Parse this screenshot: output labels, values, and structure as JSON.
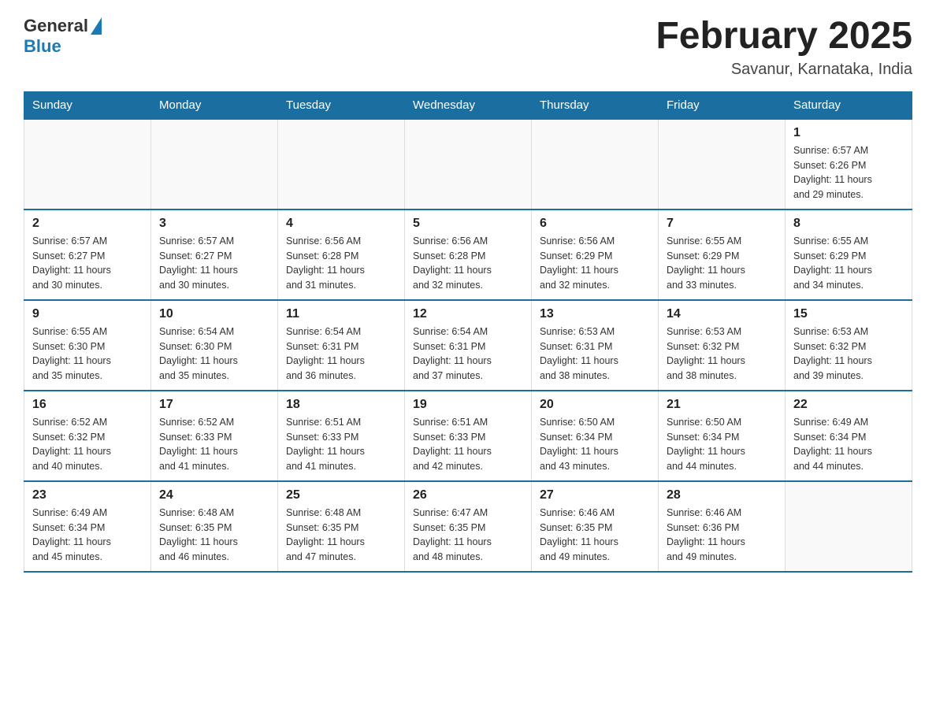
{
  "logo": {
    "general": "General",
    "blue": "Blue"
  },
  "title": "February 2025",
  "location": "Savanur, Karnataka, India",
  "days_of_week": [
    "Sunday",
    "Monday",
    "Tuesday",
    "Wednesday",
    "Thursday",
    "Friday",
    "Saturday"
  ],
  "weeks": [
    {
      "days": [
        {
          "date": "",
          "info": ""
        },
        {
          "date": "",
          "info": ""
        },
        {
          "date": "",
          "info": ""
        },
        {
          "date": "",
          "info": ""
        },
        {
          "date": "",
          "info": ""
        },
        {
          "date": "",
          "info": ""
        },
        {
          "date": "1",
          "info": "Sunrise: 6:57 AM\nSunset: 6:26 PM\nDaylight: 11 hours\nand 29 minutes."
        }
      ]
    },
    {
      "days": [
        {
          "date": "2",
          "info": "Sunrise: 6:57 AM\nSunset: 6:27 PM\nDaylight: 11 hours\nand 30 minutes."
        },
        {
          "date": "3",
          "info": "Sunrise: 6:57 AM\nSunset: 6:27 PM\nDaylight: 11 hours\nand 30 minutes."
        },
        {
          "date": "4",
          "info": "Sunrise: 6:56 AM\nSunset: 6:28 PM\nDaylight: 11 hours\nand 31 minutes."
        },
        {
          "date": "5",
          "info": "Sunrise: 6:56 AM\nSunset: 6:28 PM\nDaylight: 11 hours\nand 32 minutes."
        },
        {
          "date": "6",
          "info": "Sunrise: 6:56 AM\nSunset: 6:29 PM\nDaylight: 11 hours\nand 32 minutes."
        },
        {
          "date": "7",
          "info": "Sunrise: 6:55 AM\nSunset: 6:29 PM\nDaylight: 11 hours\nand 33 minutes."
        },
        {
          "date": "8",
          "info": "Sunrise: 6:55 AM\nSunset: 6:29 PM\nDaylight: 11 hours\nand 34 minutes."
        }
      ]
    },
    {
      "days": [
        {
          "date": "9",
          "info": "Sunrise: 6:55 AM\nSunset: 6:30 PM\nDaylight: 11 hours\nand 35 minutes."
        },
        {
          "date": "10",
          "info": "Sunrise: 6:54 AM\nSunset: 6:30 PM\nDaylight: 11 hours\nand 35 minutes."
        },
        {
          "date": "11",
          "info": "Sunrise: 6:54 AM\nSunset: 6:31 PM\nDaylight: 11 hours\nand 36 minutes."
        },
        {
          "date": "12",
          "info": "Sunrise: 6:54 AM\nSunset: 6:31 PM\nDaylight: 11 hours\nand 37 minutes."
        },
        {
          "date": "13",
          "info": "Sunrise: 6:53 AM\nSunset: 6:31 PM\nDaylight: 11 hours\nand 38 minutes."
        },
        {
          "date": "14",
          "info": "Sunrise: 6:53 AM\nSunset: 6:32 PM\nDaylight: 11 hours\nand 38 minutes."
        },
        {
          "date": "15",
          "info": "Sunrise: 6:53 AM\nSunset: 6:32 PM\nDaylight: 11 hours\nand 39 minutes."
        }
      ]
    },
    {
      "days": [
        {
          "date": "16",
          "info": "Sunrise: 6:52 AM\nSunset: 6:32 PM\nDaylight: 11 hours\nand 40 minutes."
        },
        {
          "date": "17",
          "info": "Sunrise: 6:52 AM\nSunset: 6:33 PM\nDaylight: 11 hours\nand 41 minutes."
        },
        {
          "date": "18",
          "info": "Sunrise: 6:51 AM\nSunset: 6:33 PM\nDaylight: 11 hours\nand 41 minutes."
        },
        {
          "date": "19",
          "info": "Sunrise: 6:51 AM\nSunset: 6:33 PM\nDaylight: 11 hours\nand 42 minutes."
        },
        {
          "date": "20",
          "info": "Sunrise: 6:50 AM\nSunset: 6:34 PM\nDaylight: 11 hours\nand 43 minutes."
        },
        {
          "date": "21",
          "info": "Sunrise: 6:50 AM\nSunset: 6:34 PM\nDaylight: 11 hours\nand 44 minutes."
        },
        {
          "date": "22",
          "info": "Sunrise: 6:49 AM\nSunset: 6:34 PM\nDaylight: 11 hours\nand 44 minutes."
        }
      ]
    },
    {
      "days": [
        {
          "date": "23",
          "info": "Sunrise: 6:49 AM\nSunset: 6:34 PM\nDaylight: 11 hours\nand 45 minutes."
        },
        {
          "date": "24",
          "info": "Sunrise: 6:48 AM\nSunset: 6:35 PM\nDaylight: 11 hours\nand 46 minutes."
        },
        {
          "date": "25",
          "info": "Sunrise: 6:48 AM\nSunset: 6:35 PM\nDaylight: 11 hours\nand 47 minutes."
        },
        {
          "date": "26",
          "info": "Sunrise: 6:47 AM\nSunset: 6:35 PM\nDaylight: 11 hours\nand 48 minutes."
        },
        {
          "date": "27",
          "info": "Sunrise: 6:46 AM\nSunset: 6:35 PM\nDaylight: 11 hours\nand 49 minutes."
        },
        {
          "date": "28",
          "info": "Sunrise: 6:46 AM\nSunset: 6:36 PM\nDaylight: 11 hours\nand 49 minutes."
        },
        {
          "date": "",
          "info": ""
        }
      ]
    }
  ]
}
